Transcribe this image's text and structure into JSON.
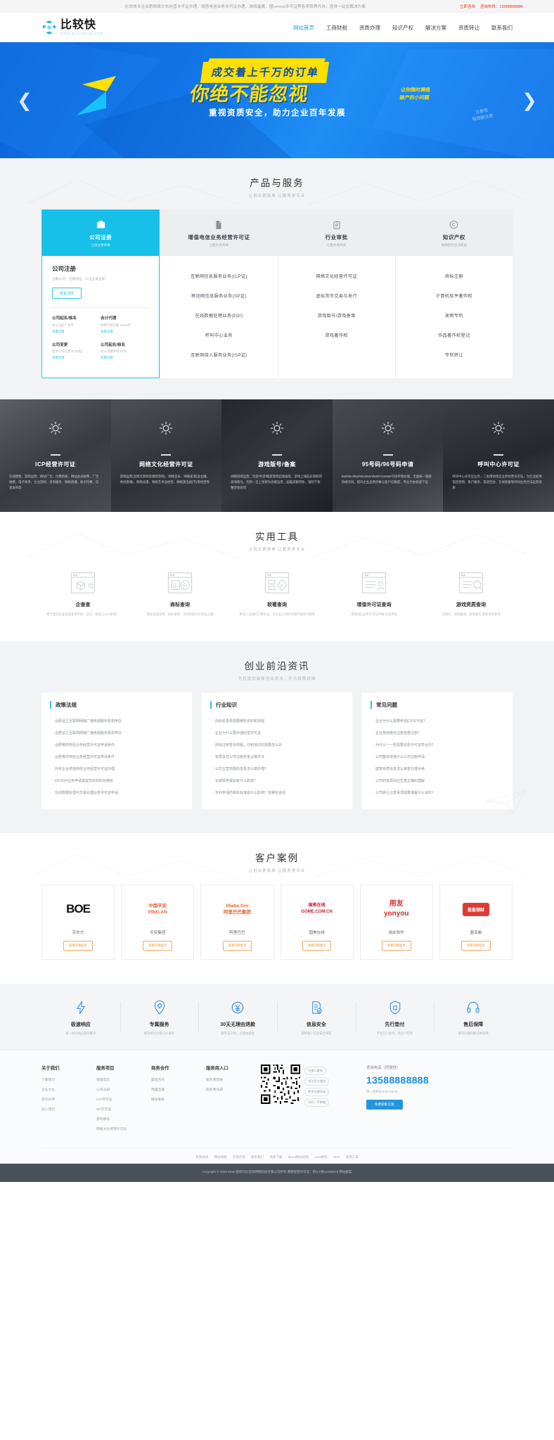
{
  "topbar": {
    "notice": "比较快专注合肥网络文化经营许可证办理、增值电信业务许可证办理、游戏备案、国versus许可证等各项资质代办，提供一站式解决方案",
    "consult_label": "立即咨询",
    "hotline_label": "咨询热线：13588888888"
  },
  "header": {
    "logo_cn": "比较快",
    "logo_url": "WWW.BIJIAOKUAI.COM",
    "nav": [
      {
        "label": "网站首页",
        "active": true
      },
      {
        "label": "工商财税",
        "active": false
      },
      {
        "label": "资质办理",
        "active": false
      },
      {
        "label": "知识产权",
        "active": false
      },
      {
        "label": "解决方案",
        "active": false
      },
      {
        "label": "资质转让",
        "active": false
      },
      {
        "label": "联系我们",
        "active": false
      }
    ]
  },
  "hero": {
    "line1": "成交着上千万的订单",
    "line2": "你绝不能忽视",
    "side": "让你随时濒临\n破产的小问题",
    "line3": "重视资质安全，助力企业百年发展",
    "stamp": "注意啦\n每周都注意",
    "prev_icon": "chevron-left-icon",
    "next_icon": "chevron-right-icon"
  },
  "products": {
    "title": "产品与服务",
    "subtitle": "让创业更简单 让服务更专业",
    "tabs": [
      {
        "title": "公司注册",
        "sub": "让创业更简单",
        "icon": "briefcase-icon",
        "active": true
      },
      {
        "title": "增值电信业务经营许可证",
        "sub": "让服务更简单",
        "icon": "document-icon",
        "active": false
      },
      {
        "title": "行业审批",
        "sub": "让服务更简单",
        "icon": "clipboard-icon",
        "active": false
      },
      {
        "title": "知识产权",
        "sub": "保障您的合法权益",
        "icon": "copyright-icon",
        "active": false
      }
    ],
    "panel_first": {
      "title": "公司注册",
      "subtitle": "注册公司 · 注册地址 · 三证五章全新",
      "button": "查看详情",
      "items": [
        {
          "name": "公司起名/核名",
          "desc": "给公司起个名字",
          "link": "查看详情"
        },
        {
          "name": "会计代理",
          "desc": "财零代理记账 ¥200/月",
          "link": "查看详情"
        },
        {
          "name": "公司变更",
          "desc": "变更公司信息 ¥700/起",
          "link": "查看详情"
        },
        {
          "name": "公司起名/核名",
          "desc": "给公司做体检 ¥100",
          "link": "查看详情"
        }
      ]
    },
    "panel_lists": [
      [
        "互联网信息服务业务(ICP证)",
        "移动网信息服务业务(SP证)",
        "在线数据处理业务(EDI)",
        "呼叫中心业务",
        "互联网接入服务业务(ISP证)"
      ],
      [
        "网络文化经营许可证",
        "虚拟货币交易与发行",
        "游戏版号/游戏备案",
        "游戏著作权"
      ],
      [
        "商标注册",
        "计算机软件著作权",
        "发明专利",
        "作品著作权登记",
        "专利转让"
      ]
    ]
  },
  "dark_cards": [
    {
      "title": "ICP经营许可证",
      "desc": "在线销售、游戏运营、网站广告、付费新闻、网站会员收费、广告收费、电子商务、企业官网、咨询服务、网络直播、知识付费、信息发布等",
      "icon": "sun-icon"
    },
    {
      "title": "网络文化经营许可证",
      "desc": "游戏运营(含网页游戏及棋牌游戏)、网络音乐、网络表演(含主播、秀场直播)、网络动漫、网络艺术品经营、网络演出剧(节)目经营等",
      "icon": "sun-icon"
    },
    {
      "title": "游戏版号/备案",
      "desc": "网络游戏运营、页游/手游/端游游戏出版备案，游戏上线前必须取得游戏版号，否则一旦上架即为违规运营，面临高额罚款、强制下架整改等处罚",
      "icon": "sun-icon"
    },
    {
      "title": "95号码/96号码申请",
      "desc": "950/951/952/953/955/95800/106988号码申请办理，全国统一客服热线号码，提升企业品牌形象与客户信赖度，专业代办快速下证",
      "icon": "sun-icon"
    },
    {
      "title": "呼叫中心许可证",
      "desc": "呼叫中心许可证业务，二类增值电信业务经营许可证，为企业提供电话营销、客户服务、电话回访、在线客服等呼叫业务合法运营资质",
      "icon": "sun-icon"
    }
  ],
  "tools": {
    "title": "实用工具",
    "subtitle": "让创业更简单 让服务更专业",
    "items": [
      {
        "name": "企查查",
        "desc": "更全面的企业信息查询平台：征信、被是让公司查询！",
        "icon": "company-search-icon"
      },
      {
        "name": "商标查询",
        "desc": "商标信息变更，商标使用，为你轻松开启创业之路",
        "icon": "trademark-search-icon"
      },
      {
        "name": "软著查询",
        "desc": "更深入全面的了解企业，为企业之间合作提供强有力保障",
        "icon": "software-copyright-icon"
      },
      {
        "name": "增值许可证查询",
        "desc": "增值电信业务许可证评级 企业评估",
        "icon": "license-search-icon"
      },
      {
        "name": "游戏资质查询",
        "desc": "文网文、游戏备案、游戏版号 游戏资质查询",
        "icon": "game-search-icon"
      }
    ]
  },
  "news": {
    "title": "创业前沿资讯",
    "subtitle": "为您提供最新创业资讯，不为政策烦恼",
    "columns": [
      {
        "head": "政策法规",
        "items": [
          "合肥设立互联网网络广播电视服务机构申办",
          "合肥设立互联网网络广播电视服务机构申办",
          "合肥等商电信业务经营许可证申请条件",
          "合肥等商电信业务经营许可证申请条件",
          "外资企业增值电信业务经营许可证办理",
          "IDC/ISP业务申请需提交的材料有哪些",
          "在线数据处理与交易处理业务许可证申请"
        ]
      },
      {
        "head": "行业知识",
        "items": [
          "商标名变更需要哪些资料和流程",
          "企业为什么要办理经营许可证",
          "商标注册查询流程，付和通过时需要怎么办",
          "有限责任公司注册资金认缴办法",
          "公司主营范围的变更怎么做办理？",
          "长期零申报会有什么影响？",
          "专利申请的相关标准有什么影响？有哪些途径"
        ]
      },
      {
        "head": "常见问题",
        "items": [
          "企业为什么需要申请ICP许可证？",
          "企业使用微信注册需要注册？",
          "为什么一一些需要这些许可证符合办？",
          "公司整体增值什么公司注册申请",
          "建筑资质信息怎么审查办理手续",
          "公司的资源对应生意正确的理解",
          "公司转让注意事项需要准备什么资料？"
        ]
      }
    ]
  },
  "cases": {
    "title": "客户案例",
    "subtitle": "让创业更简单 让服务更专业",
    "items": [
      {
        "logo_text": "BOE",
        "name": "京东方",
        "btn": "查看同款服务"
      },
      {
        "logo_text": "中国平安\nPING AN",
        "name": "平安集团",
        "btn": "查看同款服务"
      },
      {
        "logo_text": "libaba Gro\n阿里巴巴集团",
        "name": "阿里巴巴",
        "btn": "查看同款服务"
      },
      {
        "logo_text": "国美在线\nGOME.COM.CN",
        "name": "国美在线",
        "btn": "查看同款服务"
      },
      {
        "logo_text": "用友\nyonyou",
        "name": "用友软件",
        "btn": "查看同款服务"
      },
      {
        "logo_text": "盈盈理财",
        "name": "盈亚嘛",
        "btn": "查看同款服务"
      }
    ]
  },
  "guarantee": [
    {
      "name": "极速响应",
      "desc": "第一时间响应您的需求",
      "icon": "lightning-icon"
    },
    {
      "name": "专属服务",
      "desc": "服务顾问全程1对1服务",
      "icon": "diamond-icon"
    },
    {
      "name": "30天无理由退款",
      "desc": "服务未开始，无理由退款",
      "icon": "yuan-refund-icon"
    },
    {
      "name": "信息安全",
      "desc": "保障客户信息安全保密",
      "icon": "shield-doc-icon"
    },
    {
      "name": "先行垫付",
      "desc": "平台先行垫付，售后少担忧",
      "icon": "shield-icon"
    },
    {
      "name": "售后保障",
      "desc": "服务问题对解决并反馈",
      "icon": "headset-icon"
    }
  ],
  "footer": {
    "columns": [
      {
        "head": "关于我们",
        "links": [
          "了解我们",
          "企业文化",
          "合作伙伴",
          "加入我们"
        ]
      },
      {
        "head": "服务项目",
        "links": [
          "增值电信",
          "公司注册",
          "ICP许可证",
          "SP许可证",
          "游戏版号",
          "网络文化经营许可证"
        ]
      },
      {
        "head": "商务合作",
        "links": [
          "渠道合作",
          "商遇互联",
          "媒体联系"
        ]
      },
      {
        "head": "服务商入口",
        "links": [
          "服务商登录",
          "服务商注册"
        ]
      }
    ],
    "qr_caption_lines": [
      "扫描二维码",
      "关注官方微信",
      "更多优惠活动",
      "扫码一手掌握"
    ],
    "contact": {
      "label": "咨询电话（同微信）",
      "phone": "13588888888",
      "hours": "周一至周日 8:00-18:00",
      "button": "免费获取方案"
    },
    "bottom_links": [
      "友情链接",
      "网站地图",
      "在线咨询",
      "联系我们",
      "免费下载",
      "about网站地图",
      "Java教程",
      "SEO",
      "常用工具"
    ],
    "copyright": "Copyright © 2002-2019 版权归比较快网络科技有限公司所有  网络经营许可证：皖ICP备12345678  网站备案"
  }
}
